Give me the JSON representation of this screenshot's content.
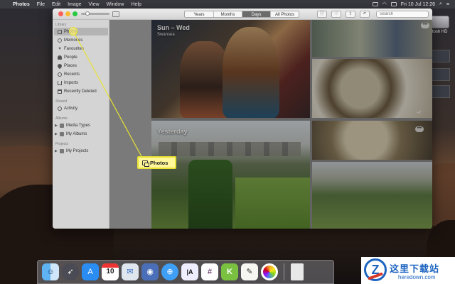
{
  "menubar": {
    "apple": "",
    "app_name": "Photos",
    "items": [
      "File",
      "Edit",
      "Image",
      "View",
      "Window",
      "Help"
    ],
    "clock": "Fri 10 Jul 12:26"
  },
  "desktop": {
    "drive_label": "ntosh HD"
  },
  "toolbar": {
    "tabs": [
      {
        "label": "Years",
        "active": false
      },
      {
        "label": "Months",
        "active": false
      },
      {
        "label": "Days",
        "active": true
      },
      {
        "label": "All Photos",
        "active": false
      }
    ],
    "search_placeholder": "Search"
  },
  "sidebar": {
    "library_header": "Library",
    "library_items": [
      {
        "label": "Photos",
        "icon": "photos-icon",
        "selected": true
      },
      {
        "label": "Memories",
        "icon": "memories-icon"
      },
      {
        "label": "Favourites",
        "icon": "heart-icon"
      },
      {
        "label": "People",
        "icon": "person-icon"
      },
      {
        "label": "Places",
        "icon": "pin-icon"
      },
      {
        "label": "Recents",
        "icon": "clock-icon"
      },
      {
        "label": "Imports",
        "icon": "import-icon"
      },
      {
        "label": "Recently Deleted",
        "icon": "trash-icon"
      }
    ],
    "shared_header": "Shared",
    "shared_items": [
      {
        "label": "Activity",
        "icon": "activity-icon"
      }
    ],
    "albums_header": "Albums",
    "albums_items": [
      {
        "label": "Media Types",
        "icon": "folder-icon"
      },
      {
        "label": "My Albums",
        "icon": "folder-icon"
      }
    ],
    "projects_header": "Projects",
    "projects_items": [
      {
        "label": "My Projects",
        "icon": "folder-icon"
      }
    ]
  },
  "main": {
    "moments": [
      {
        "title": "Sun – Wed",
        "location": "Swansea"
      },
      {
        "title": "Yesterday",
        "location": ""
      }
    ],
    "more_label": "•••",
    "plus_count": "+2"
  },
  "callout": {
    "label": "Photos",
    "color": "#fff79a"
  },
  "dock": {
    "calendar_day": "10",
    "apps": [
      "Finder",
      "Launchpad",
      "App Store",
      "Calendar",
      "Mail",
      "Podcasts",
      "Safari",
      "iA Writer",
      "Slack",
      "Keka",
      "TextEdit",
      "Photos",
      "Document"
    ]
  },
  "watermark": {
    "cn": "这里下载站",
    "en": "heredown.com"
  }
}
